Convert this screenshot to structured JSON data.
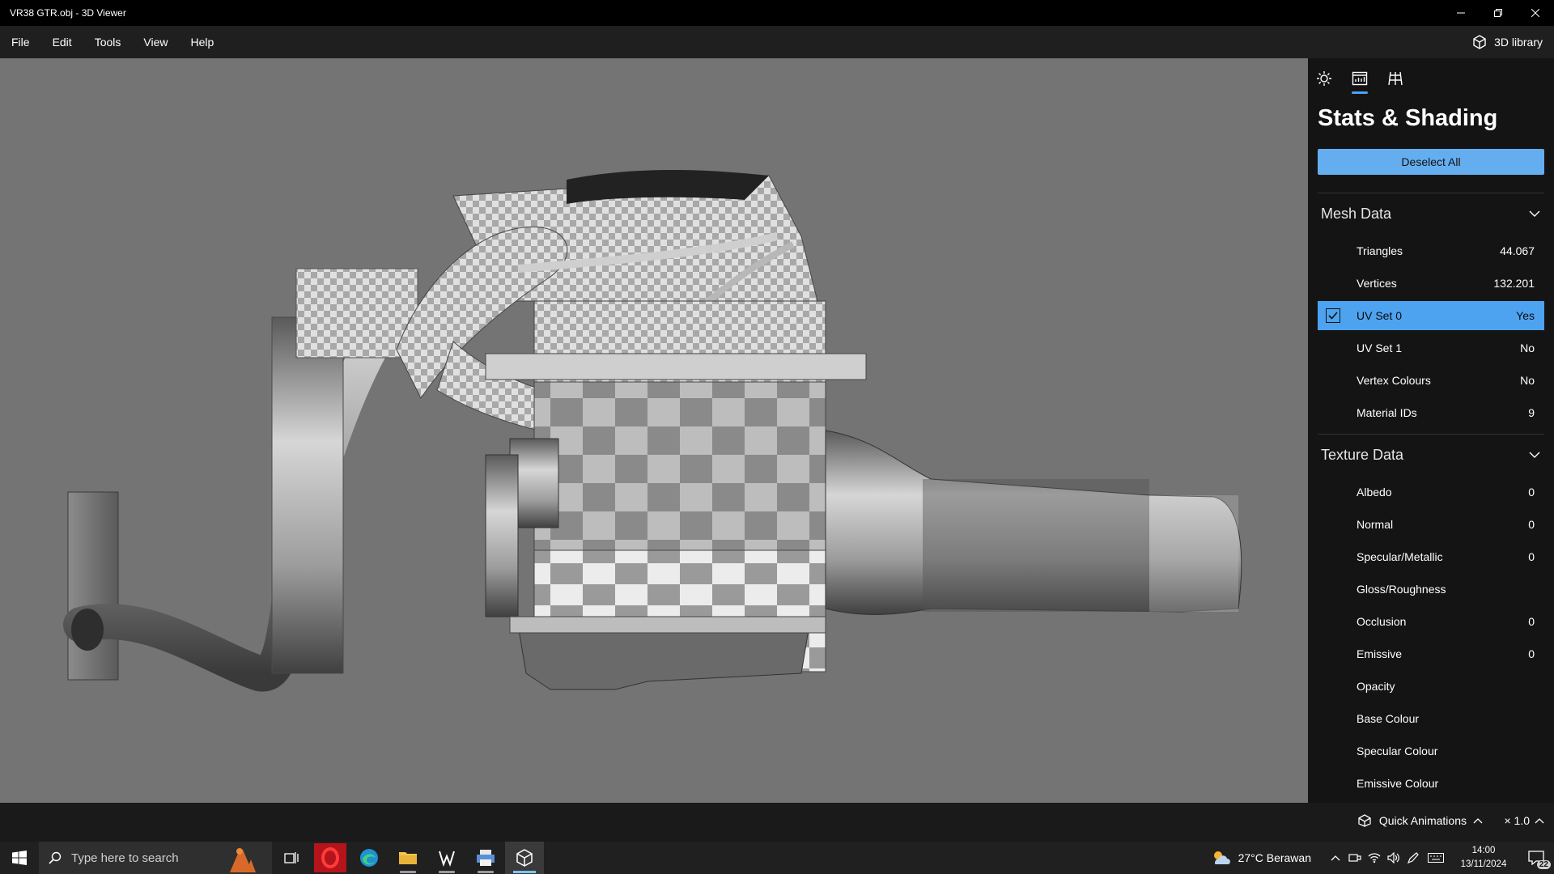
{
  "window": {
    "title": "VR38 GTR.obj - 3D Viewer"
  },
  "menu": {
    "items": [
      "File",
      "Edit",
      "Tools",
      "View",
      "Help"
    ],
    "library_label": "3D library"
  },
  "panel": {
    "title": "Stats & Shading",
    "deselect_label": "Deselect All",
    "mesh": {
      "header": "Mesh Data",
      "rows": [
        {
          "label": "Triangles",
          "value": "44.067"
        },
        {
          "label": "Vertices",
          "value": "132.201"
        },
        {
          "label": "UV Set 0",
          "value": "Yes"
        },
        {
          "label": "UV Set 1",
          "value": "No"
        },
        {
          "label": "Vertex Colours",
          "value": "No"
        },
        {
          "label": "Material IDs",
          "value": "9"
        }
      ]
    },
    "texture": {
      "header": "Texture Data",
      "rows": [
        {
          "label": "Albedo",
          "value": "0"
        },
        {
          "label": "Normal",
          "value": "0"
        },
        {
          "label": "Specular/Metallic",
          "value": "0"
        },
        {
          "label": "Gloss/Roughness",
          "value": ""
        },
        {
          "label": "Occlusion",
          "value": "0"
        },
        {
          "label": "Emissive",
          "value": "0"
        },
        {
          "label": "Opacity",
          "value": ""
        },
        {
          "label": "Base Colour",
          "value": ""
        },
        {
          "label": "Specular Colour",
          "value": ""
        },
        {
          "label": "Emissive Colour",
          "value": ""
        }
      ]
    }
  },
  "status": {
    "quick_animations": "Quick Animations",
    "speed": "× 1.0"
  },
  "taskbar": {
    "search_placeholder": "Type here to search",
    "weather": "27°C  Berawan",
    "time": "14:00",
    "date": "13/11/2024",
    "notifications": "22"
  },
  "colors": {
    "accent": "#4ea3f0",
    "viewport": "#747474",
    "panel": "#141414"
  }
}
